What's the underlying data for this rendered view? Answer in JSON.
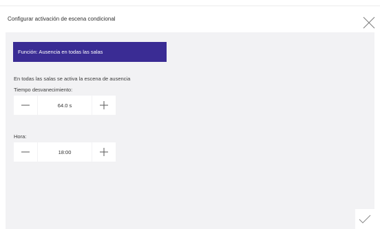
{
  "dialog": {
    "title": "Configurar activación de escena condicional"
  },
  "function_banner": {
    "label": "Función: Ausencia en todas las salas",
    "color": "#3a2c94"
  },
  "info": {
    "text": "En todas las salas se activa la escena de ausencia"
  },
  "fade": {
    "label": "Tiempo desvanecimiento:",
    "value": "64.0 s"
  },
  "time": {
    "label": "Hora:",
    "value": "18:00"
  },
  "icons": {
    "close": "close-icon",
    "minus": "minus-icon",
    "plus": "plus-icon",
    "confirm": "checkmark-icon"
  }
}
